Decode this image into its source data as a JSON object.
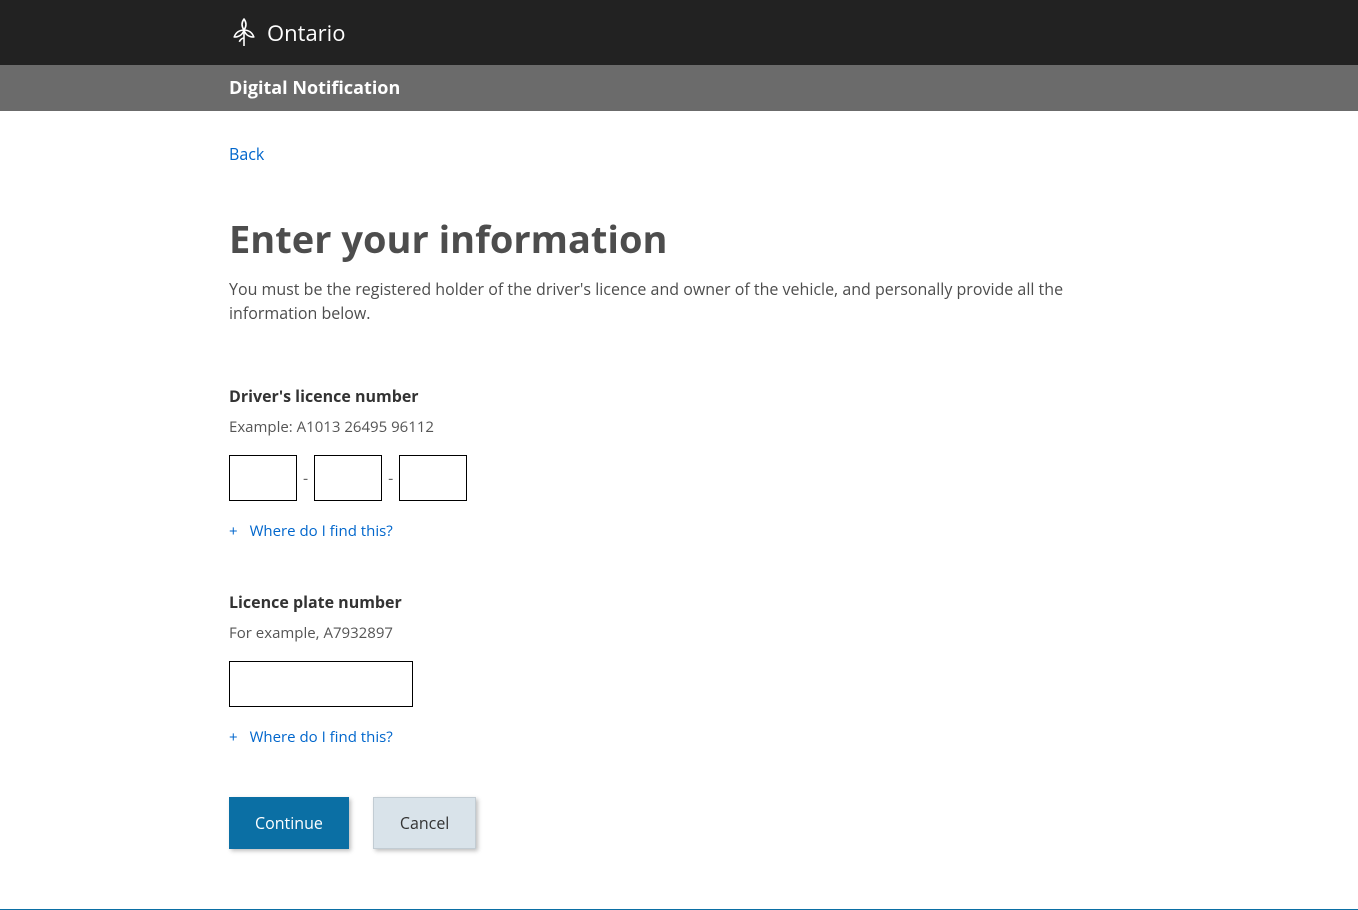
{
  "header": {
    "brand": "Ontario",
    "sub_title": "Digital Notification"
  },
  "nav": {
    "back_label": "Back"
  },
  "page": {
    "title": "Enter your information",
    "description": "You must be the registered holder of the driver's licence and owner of the vehicle, and personally provide all the information below."
  },
  "dln": {
    "label": "Driver's licence number",
    "example": "Example: A1013 26495 96112",
    "separator": "-",
    "help_icon": "+",
    "help_label": "Where do I find this?",
    "part1": "",
    "part2": "",
    "part3": ""
  },
  "plate": {
    "label": "Licence plate number",
    "example": "For example, A7932897",
    "value": "",
    "help_icon": "+",
    "help_label": "Where do I find this?"
  },
  "buttons": {
    "continue": "Continue",
    "cancel": "Cancel"
  }
}
